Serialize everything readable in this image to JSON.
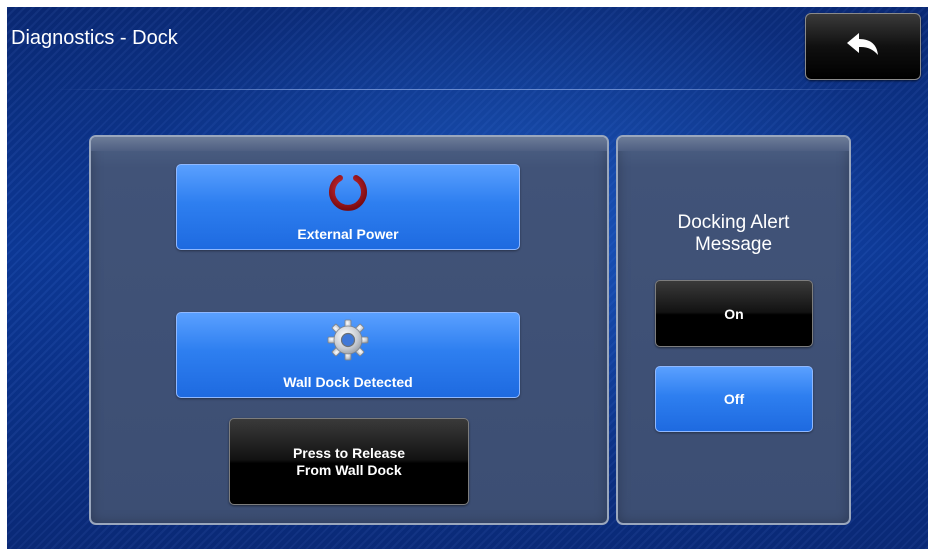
{
  "header": {
    "title": "Diagnostics - Dock",
    "back_icon": "back-arrow-icon"
  },
  "left_panel": {
    "external_power": {
      "label": "External Power",
      "icon": "power-icon",
      "icon_color": "#b3121a"
    },
    "wall_dock": {
      "label": "Wall Dock Detected",
      "icon": "gear-icon"
    },
    "release_button": {
      "line1": "Press to Release",
      "line2": "From Wall Dock"
    }
  },
  "right_panel": {
    "title_line1": "Docking Alert",
    "title_line2": "Message",
    "on_label": "On",
    "off_label": "Off",
    "selected": "Off"
  },
  "colors": {
    "background": "#0c3a9c",
    "active_button": "#2e7ff0",
    "inactive_button": "#000000",
    "panel": "#415378"
  }
}
